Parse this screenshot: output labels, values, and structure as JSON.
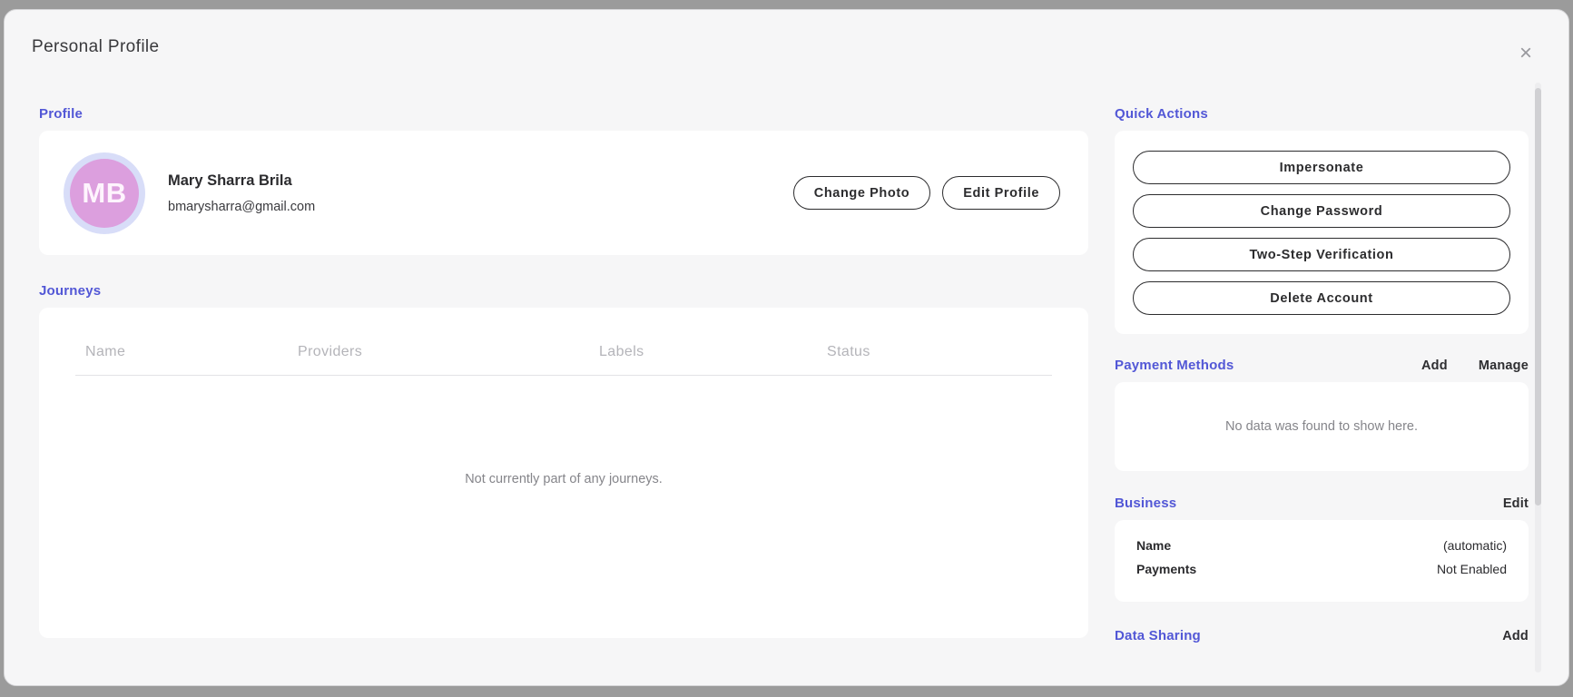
{
  "window": {
    "title": "Personal Profile",
    "close_icon": "×"
  },
  "profile": {
    "section_label": "Profile",
    "avatar_initials": "MB",
    "name": "Mary Sharra Brila",
    "email": "bmarysharra@gmail.com",
    "change_photo_label": "Change Photo",
    "edit_profile_label": "Edit Profile"
  },
  "journeys": {
    "section_label": "Journeys",
    "columns": [
      "Name",
      "Providers",
      "Labels",
      "Status"
    ],
    "empty_message": "Not currently part of any journeys."
  },
  "quick_actions": {
    "section_label": "Quick Actions",
    "buttons": [
      "Impersonate",
      "Change Password",
      "Two-Step Verification",
      "Delete Account"
    ]
  },
  "payment_methods": {
    "section_label": "Payment Methods",
    "add_label": "Add",
    "manage_label": "Manage",
    "empty_message": "No data was found to show here."
  },
  "business": {
    "section_label": "Business",
    "edit_label": "Edit",
    "rows": [
      {
        "label": "Name",
        "value": "(automatic)"
      },
      {
        "label": "Payments",
        "value": "Not Enabled"
      }
    ]
  },
  "data_sharing": {
    "section_label": "Data Sharing",
    "add_label": "Add"
  },
  "colors": {
    "accent": "#5257d6",
    "avatar_fill": "#dc9fde",
    "avatar_ring": "#d8ddf8",
    "frame": "#9b9b9b",
    "modal_background": "#f6f6f7"
  }
}
